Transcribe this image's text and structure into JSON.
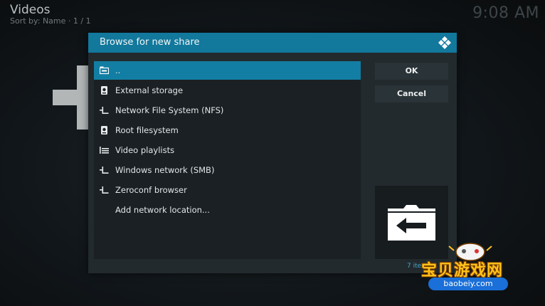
{
  "header": {
    "title": "Videos",
    "sort": "Sort by: Name  ·  1 / 1",
    "clock": "9:08 AM"
  },
  "dialog": {
    "title": "Browse for new share",
    "items": [
      {
        "label": "..",
        "icon": "folder-drive-icon",
        "selected": true
      },
      {
        "label": "External storage",
        "icon": "hard-disk-icon"
      },
      {
        "label": "Network File System (NFS)",
        "icon": "network-icon"
      },
      {
        "label": "Root filesystem",
        "icon": "hard-disk-icon"
      },
      {
        "label": "Video playlists",
        "icon": "playlist-icon"
      },
      {
        "label": "Windows network (SMB)",
        "icon": "network-icon"
      },
      {
        "label": "Zeroconf browser",
        "icon": "network-icon"
      },
      {
        "label": "Add network location...",
        "icon": ""
      }
    ],
    "ok_label": "OK",
    "cancel_label": "Cancel",
    "item_count": "7 ite",
    "accent_color": "#12789c"
  },
  "watermark": {
    "text": "宝贝游戏网",
    "url": "baobeiy.com"
  }
}
